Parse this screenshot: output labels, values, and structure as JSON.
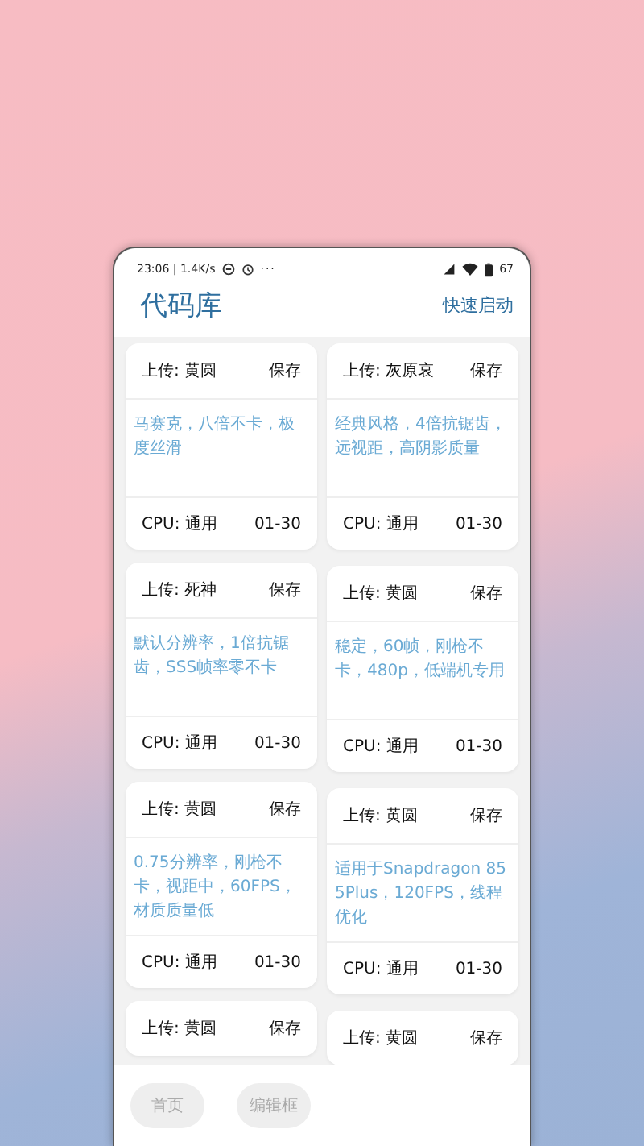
{
  "status_bar": {
    "time": "23:06 |",
    "speed": "1.4K/s",
    "more": "···",
    "battery": "67"
  },
  "header": {
    "title": "代码库",
    "action": "快速启动"
  },
  "cards": [
    {
      "uploader": "上传: 黄圆",
      "save": "保存",
      "description": "马赛克，八倍不卡，极度丝滑",
      "cpu": "CPU: 通用",
      "range": "01-30"
    },
    {
      "uploader": "上传: 灰原哀",
      "save": "保存",
      "description": "经典风格，4倍抗锯齿，远视距，高阴影质量",
      "cpu": "CPU: 通用",
      "range": "01-30"
    },
    {
      "uploader": "上传: 死神",
      "save": "保存",
      "description": "默认分辨率，1倍抗锯齿，SSS帧率零不卡",
      "cpu": "CPU: 通用",
      "range": "01-30"
    },
    {
      "uploader": "上传: 黄圆",
      "save": "保存",
      "description": "稳定，60帧，刚枪不卡，480p，低端机专用",
      "cpu": "CPU: 通用",
      "range": "01-30"
    },
    {
      "uploader": "上传: 黄圆",
      "save": "保存",
      "description": "0.75分辨率，刚枪不卡，视距中，60FPS，材质质量低",
      "cpu": "CPU: 通用",
      "range": "01-30"
    },
    {
      "uploader": "上传: 黄圆",
      "save": "保存",
      "description": "适用于Snapdragon 855Plus，120FPS，线程优化",
      "cpu": "CPU: 通用",
      "range": "01-30"
    },
    {
      "uploader": "上传: 黄圆",
      "save": "保存"
    },
    {
      "uploader": "上传: 黄圆",
      "save": "保存"
    }
  ],
  "bottom_nav": [
    "首页",
    "编辑框"
  ]
}
